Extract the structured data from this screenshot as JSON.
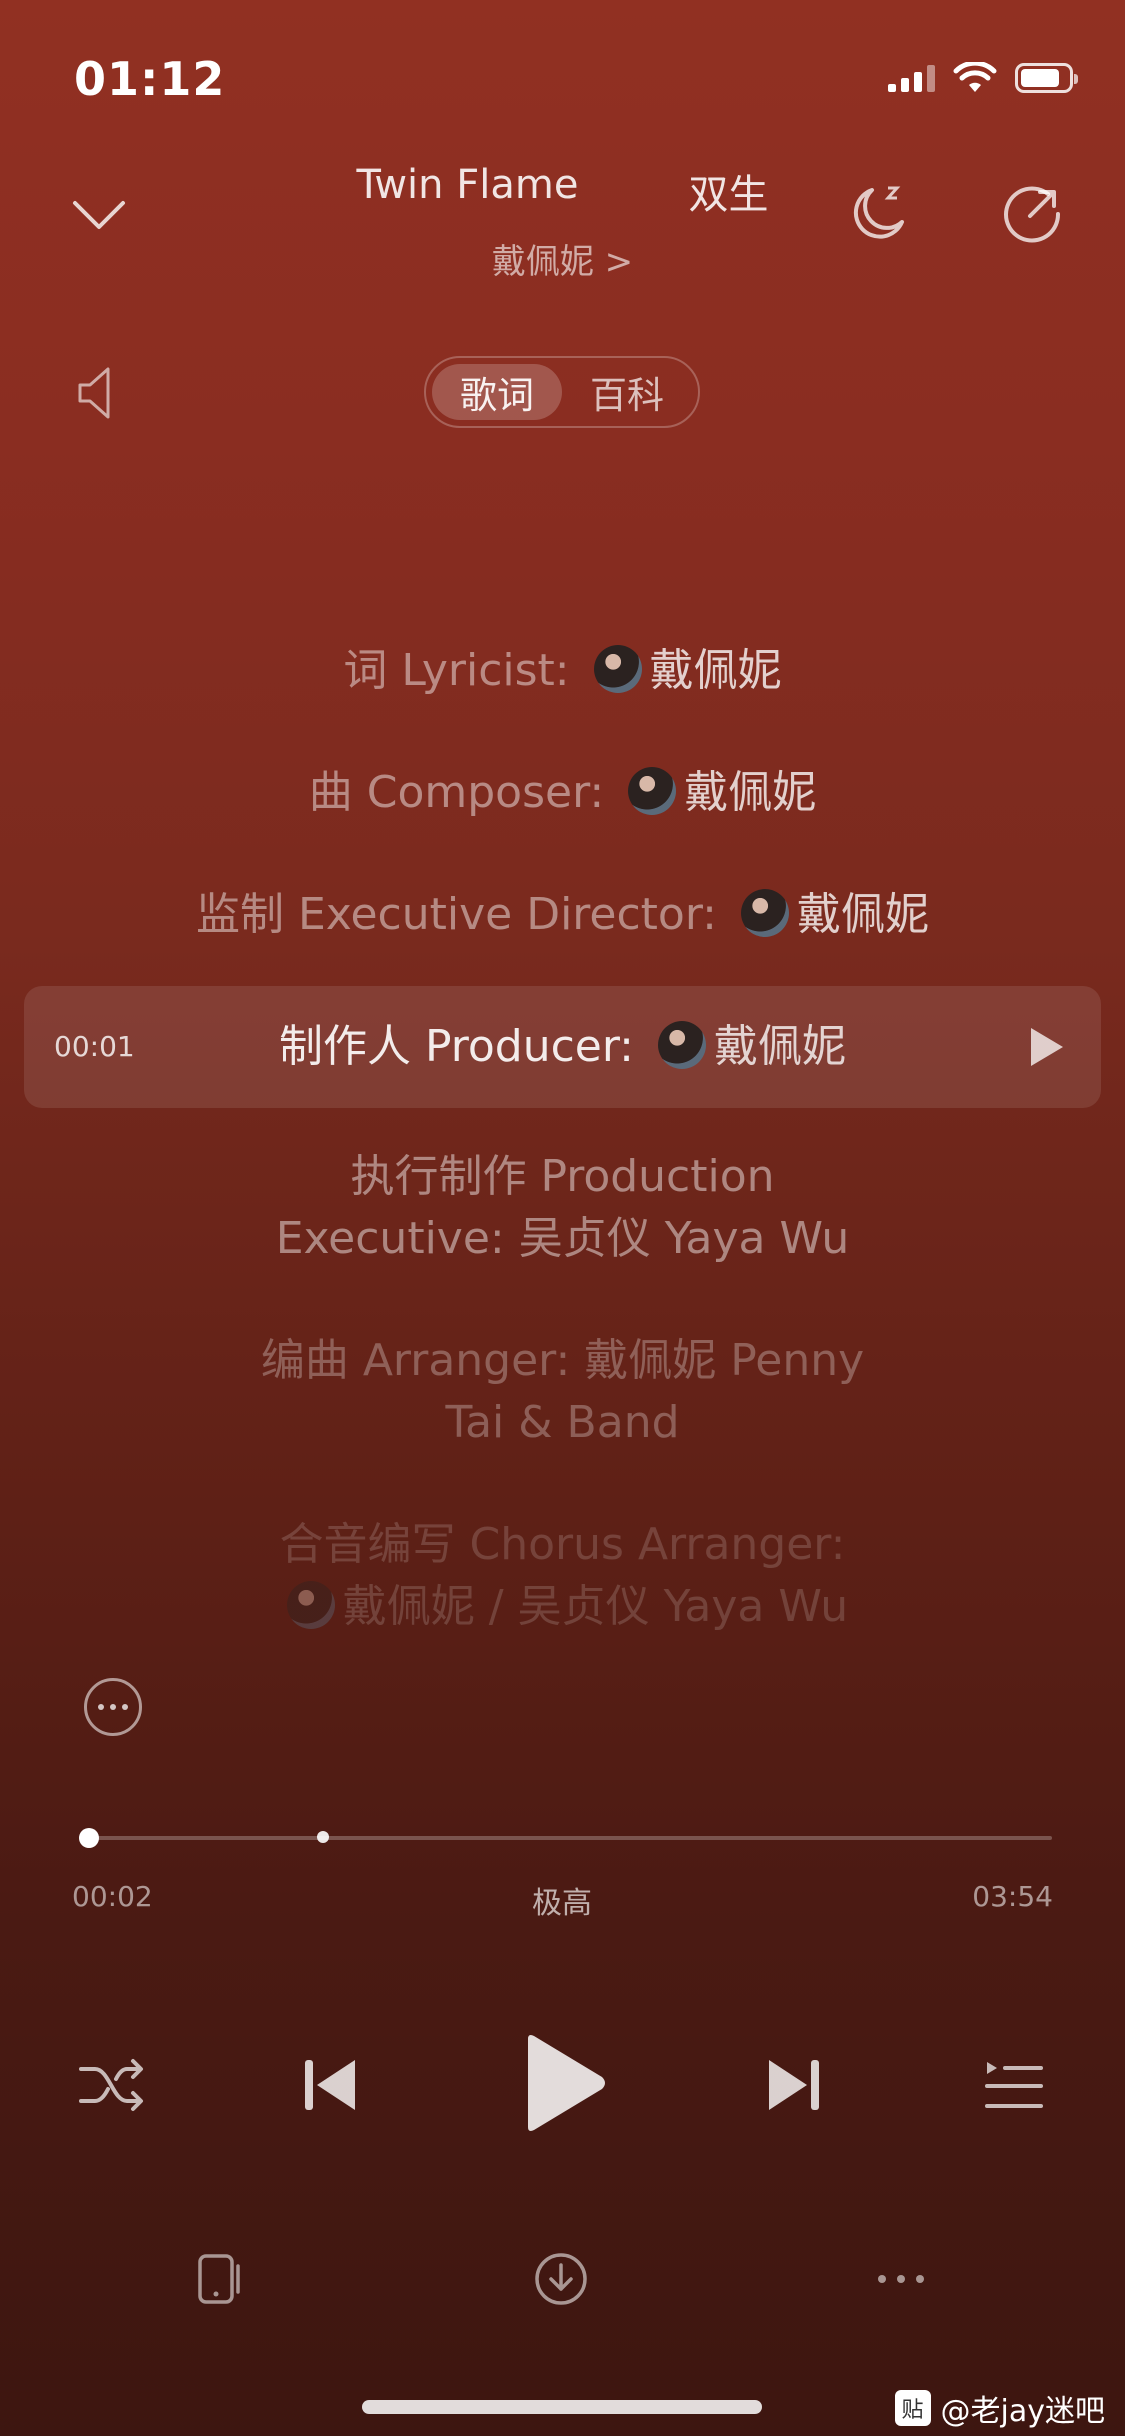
{
  "status": {
    "time": "01:12"
  },
  "header": {
    "title_en": "Twin Flame",
    "title_cn": "双生",
    "artist": "戴佩妮 >"
  },
  "tabs": [
    {
      "label": "歌词",
      "active": true
    },
    {
      "label": "百科",
      "active": false
    }
  ],
  "lyrics": [
    {
      "prefix": "词 Lyricist:",
      "name": "戴佩妮"
    },
    {
      "prefix": "曲 Composer:",
      "name": "戴佩妮"
    },
    {
      "prefix": "监制 Executive Director:",
      "name": "戴佩妮"
    },
    {
      "prefix": "制作人 Producer:",
      "name": "戴佩妮",
      "time": "00:01"
    },
    {
      "text": "执行制作 Production Executive:  吴贞仪 Yaya Wu"
    },
    {
      "text": "编曲 Arranger:  戴佩妮 Penny Tai & Band"
    },
    {
      "text1": "合音编写 Chorus Arranger:",
      "text2": "戴佩妮  /  吴贞仪 Yaya Wu"
    }
  ],
  "playback": {
    "elapsed": "00:02",
    "duration": "03:54",
    "quality": "极高",
    "progress_fraction": 0.009,
    "buffer_fraction": 0.25
  },
  "watermark": {
    "logo": "贴",
    "text": "@老jay迷吧"
  }
}
